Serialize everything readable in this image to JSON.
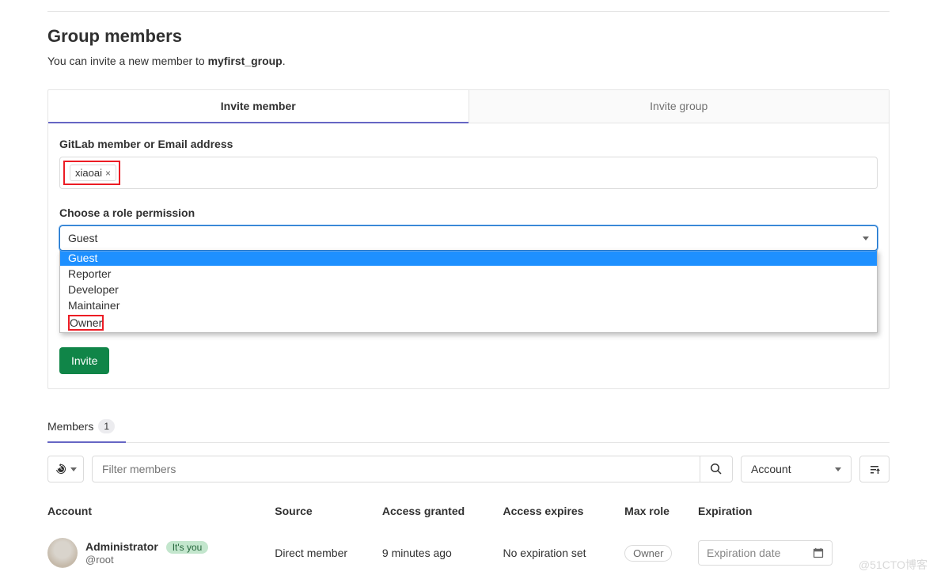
{
  "header": {
    "title": "Group members",
    "subhead_prefix": "You can invite a new member to ",
    "group_name": "myfirst_group",
    "subhead_suffix": "."
  },
  "tabs": {
    "invite_member": "Invite member",
    "invite_group": "Invite group"
  },
  "invite": {
    "member_label": "GitLab member or Email address",
    "token_value": "xiaoai",
    "role_label": "Choose a role permission",
    "selected_role": "Guest",
    "options": [
      "Guest",
      "Reporter",
      "Developer",
      "Maintainer",
      "Owner"
    ],
    "invite_button": "Invite"
  },
  "members_tab": {
    "label": "Members",
    "count": "1"
  },
  "toolbar": {
    "filter_placeholder": "Filter members",
    "sort_label": "Account"
  },
  "columns": {
    "account": "Account",
    "source": "Source",
    "granted": "Access granted",
    "expires": "Access expires",
    "maxrole": "Max role",
    "expiration": "Expiration"
  },
  "rows": [
    {
      "name": "Administrator",
      "you_badge": "It's you",
      "username": "@root",
      "source": "Direct member",
      "granted": "9 minutes ago",
      "expires": "No expiration set",
      "maxrole": "Owner",
      "expiration_placeholder": "Expiration date"
    }
  ],
  "watermark": "@51CTO博客"
}
